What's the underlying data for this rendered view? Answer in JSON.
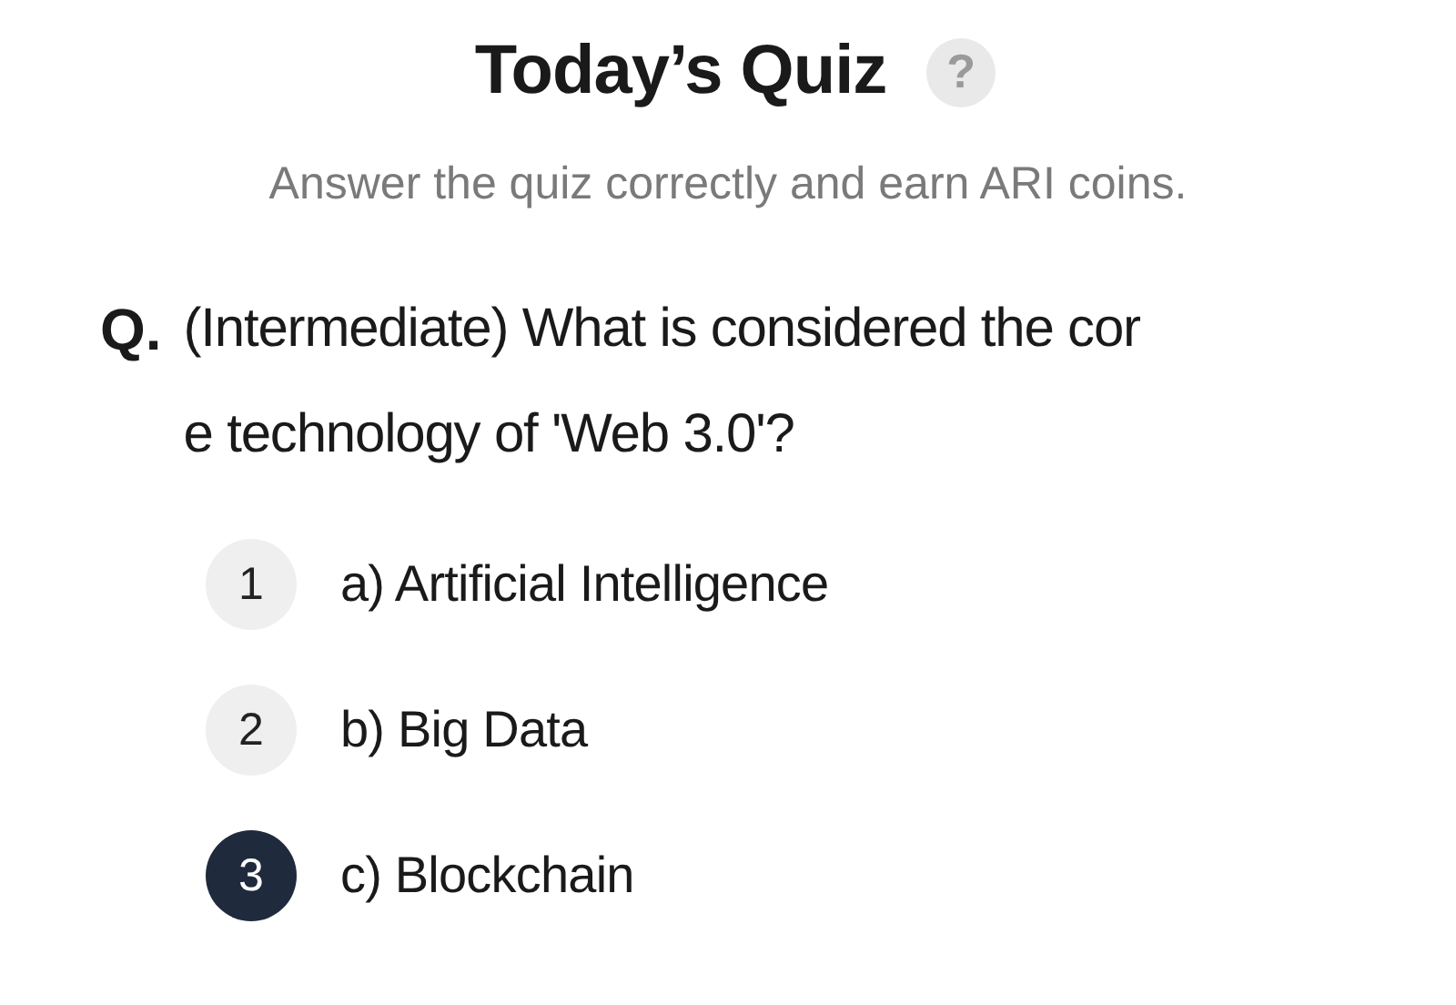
{
  "title": "Today’s Quiz",
  "help_icon": "?",
  "subtitle": "Answer the quiz correctly and earn ARI coins.",
  "question": {
    "prefix": "Q.",
    "lines": [
      "(Intermediate) What is considered the cor",
      "e technology of 'Web 3.0'?"
    ]
  },
  "options": [
    {
      "number": "1",
      "label": "a) Artificial Intelligence",
      "selected": false
    },
    {
      "number": "2",
      "label": "b) Big Data",
      "selected": false
    },
    {
      "number": "3",
      "label": "c) Blockchain",
      "selected": true
    }
  ]
}
